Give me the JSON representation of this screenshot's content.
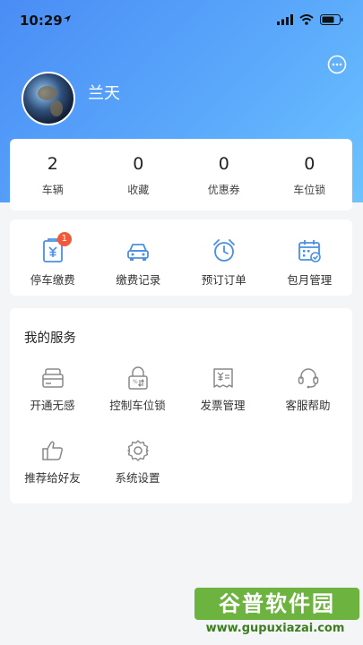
{
  "status_bar": {
    "time": "10:29"
  },
  "profile": {
    "name": "兰天"
  },
  "stats": [
    {
      "value": "2",
      "label": "车辆"
    },
    {
      "value": "0",
      "label": "收藏"
    },
    {
      "value": "0",
      "label": "优惠券"
    },
    {
      "value": "0",
      "label": "车位锁"
    }
  ],
  "quick_actions": [
    {
      "label": "停车缴费",
      "badge": "1",
      "icon": "parking-receipt-icon"
    },
    {
      "label": "缴费记录",
      "icon": "car-icon"
    },
    {
      "label": "预订订单",
      "icon": "alarm-clock-icon"
    },
    {
      "label": "包月管理",
      "icon": "calendar-check-icon"
    }
  ],
  "services": {
    "title": "我的服务",
    "items": [
      {
        "label": "开通无感",
        "icon": "card-icon"
      },
      {
        "label": "控制车位锁",
        "icon": "lock-icon"
      },
      {
        "label": "发票管理",
        "icon": "invoice-icon"
      },
      {
        "label": "客服帮助",
        "icon": "headset-icon"
      },
      {
        "label": "推荐给好友",
        "icon": "thumbs-up-icon"
      },
      {
        "label": "系统设置",
        "icon": "gear-icon"
      }
    ]
  },
  "watermark": {
    "brand": "谷普软件园",
    "url": "www.gupuxiazai.com"
  },
  "colors": {
    "accent": "#4a8df5",
    "icon_blue": "#4a90e2",
    "badge": "#f2593b"
  }
}
